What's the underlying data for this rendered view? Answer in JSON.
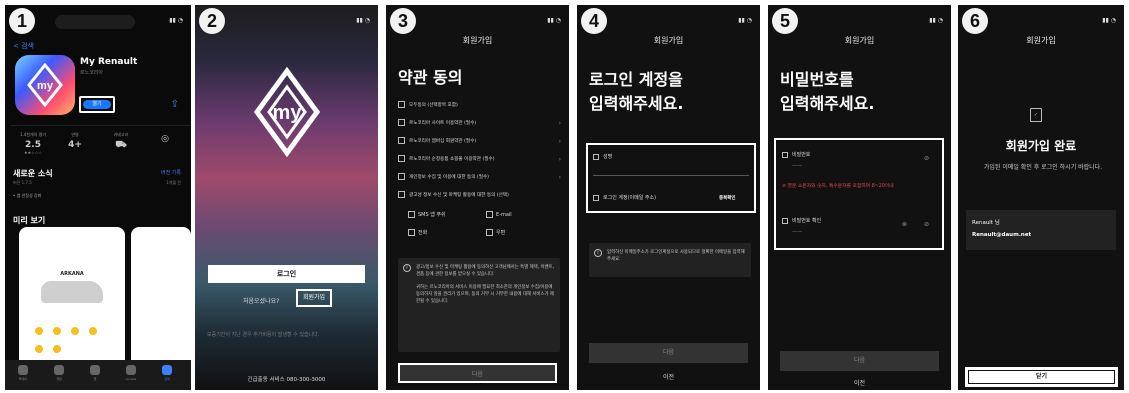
{
  "steps": [
    "1",
    "2",
    "3",
    "4",
    "5",
    "6"
  ],
  "phone1": {
    "back": "< 검색",
    "app_name": "My Renault",
    "app_sub": "르노코리아",
    "open_label": "열기",
    "stats": [
      {
        "label": "1.4천개의 평가",
        "value": "2.5"
      },
      {
        "label": "연령",
        "value": "4+"
      },
      {
        "label": "카테고리",
        "value": ""
      },
      {
        "label": "",
        "value": ""
      }
    ],
    "news_title": "새로운 소식",
    "news_link": "버전 기록",
    "news_version": "버전 1.7.5",
    "news_days": "1개월 전",
    "news_desc": "• 앱 안정성 강화",
    "preview_title": "미리 보기",
    "car_title": "ARKANA",
    "tabs": [
      "투데이",
      "게임",
      "앱",
      "Arcade",
      "검색"
    ]
  },
  "phone2": {
    "login": "로그인",
    "first_q": "처음오셨나요?",
    "signup": "회원가입",
    "warn": "보증기간이 지난 경우 추가비용이 발생할 수 있습니다.",
    "emergency": "긴급출동 서비스 080-300-3000"
  },
  "phone3": {
    "title": "회원가입",
    "heading": "약관 동의",
    "items": [
      "모두동의 (선택항목 포함)",
      "르노코리아 사이트 이용약관 (필수)",
      "르노코리아 멤버십 회원약관 (필수)",
      "르노코리아 순정용품 쇼핑몰 이용약관 (필수)",
      "개인정보 수집 및 이용에 대한 동의 (필수)",
      "광고성 정보 수신 및 마케팅 활용에 대한 동의 (선택)"
    ],
    "sub": [
      "SMS 앱 푸쉬",
      "E-mail",
      "전화",
      "우편"
    ],
    "info1": "광고/정보 수신 및 마케팅 활용에 동의하신 고객님께서는 특별 혜택, 이벤트, 경품 등에 관한 정보를 받으실 수 있습니다.",
    "info2": "귀하는 르노코리아의 서비스 이용에 필요한 최소한의 개인정보 수집/이용에 동의하지 않을 권리가 있으며, 동의 거부 시 거부한 내용에 대해 서비스가 제한될 수 있습니다.",
    "next": "다음"
  },
  "phone4": {
    "title": "회원가입",
    "heading_l1": "로그인 계정을",
    "heading_l2": "입력해주세요.",
    "name_label": "성명",
    "email_placeholder": "로그인 계정(이메일 주소)",
    "verify": "중복확인",
    "info": "입력하신 이메일주소가 로그인계정으로 사용되므로 정확한 이메일을 입력해주세요.",
    "next": "다음",
    "prev": "이전"
  },
  "phone5": {
    "title": "회원가입",
    "heading_l1": "비밀번호를",
    "heading_l2": "입력해주세요.",
    "pw_label": "비밀번호",
    "pw_value": "——",
    "error": "영문 소문자와 숫자, 특수문자를 포함하여 8~20이내",
    "pw_confirm_label": "비밀번호 확인",
    "next": "다음",
    "prev": "이전"
  },
  "phone6": {
    "title": "회원가입",
    "done_title": "회원가입 완료",
    "done_desc": "가입된 이메일 확인 후 로그인 하시기 바랍니다.",
    "user_name": "Renault 님",
    "user_email": "Renault@daum.net",
    "close": "닫기"
  }
}
